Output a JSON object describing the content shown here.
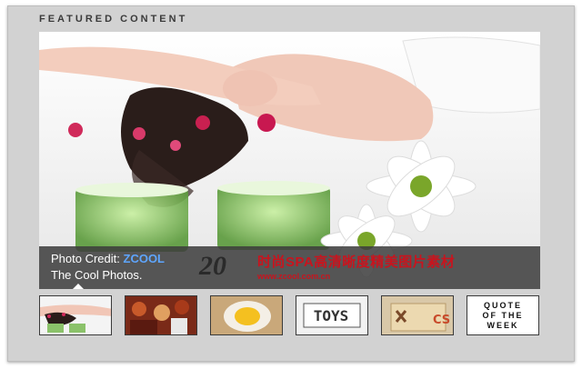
{
  "section": {
    "title": "FEATURED CONTENT"
  },
  "slide": {
    "credit_label": "Photo Credit:",
    "credit_link": "ZCOOL",
    "subtitle": "The Cool Photos.",
    "number": "20",
    "cn_title": "时尚SPA高清晰度精美图片素材",
    "cn_url": "www.zcool.com.cn"
  },
  "thumbnails": [
    {
      "icon": "spa-woman-thumbnail"
    },
    {
      "icon": "crowd-thumbnail"
    },
    {
      "icon": "egg-plate-thumbnail"
    },
    {
      "icon": "toys-letters-thumbnail"
    },
    {
      "icon": "tag-cs-thumbnail"
    },
    {
      "icon": "quote-of-the-week-thumbnail",
      "lines": [
        "QUOTE",
        "OF THE",
        "WEEK"
      ]
    }
  ],
  "colors": {
    "frame": "#d2d2d2",
    "link": "#5ea6ff",
    "cn_text": "#c8141e"
  }
}
